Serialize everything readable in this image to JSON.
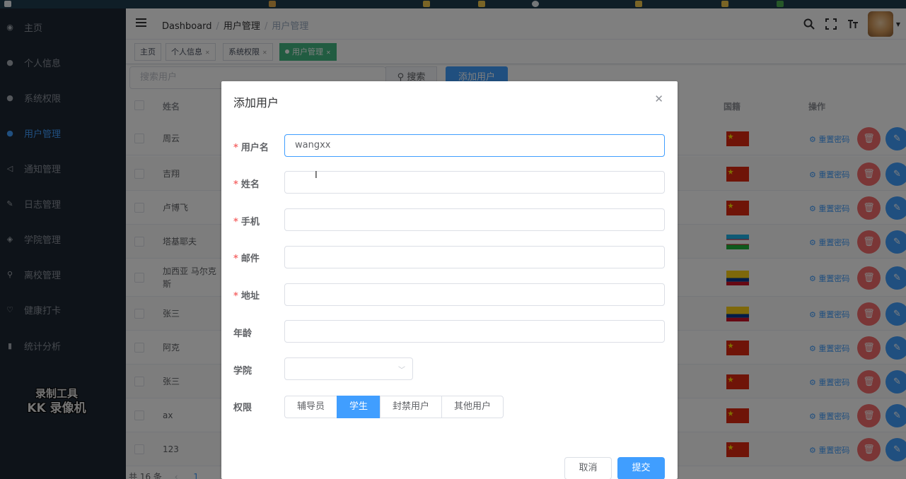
{
  "sidebar": {
    "items": [
      {
        "label": "主页",
        "icon": "dashboard-icon"
      },
      {
        "label": "个人信息",
        "icon": "user-icon"
      },
      {
        "label": "系统权限",
        "icon": "user-icon"
      },
      {
        "label": "用户管理",
        "icon": "users-icon",
        "active": true
      },
      {
        "label": "通知管理",
        "icon": "bell-icon"
      },
      {
        "label": "日志管理",
        "icon": "pen-icon"
      },
      {
        "label": "学院管理",
        "icon": "heart-icon"
      },
      {
        "label": "离校管理",
        "icon": "run-icon"
      },
      {
        "label": "健康打卡",
        "icon": "heart-outline-icon"
      },
      {
        "label": "统计分析",
        "icon": "bar-chart-icon"
      }
    ],
    "watermark": {
      "line1": "录制工具",
      "line2": "KK 录像机"
    }
  },
  "navbar": {
    "breadcrumb": [
      "Dashboard",
      "用户管理",
      "用户管理"
    ]
  },
  "tags": [
    {
      "label": "主页",
      "closable": false
    },
    {
      "label": "个人信息",
      "closable": true
    },
    {
      "label": "系统权限",
      "closable": true
    },
    {
      "label": "用户管理",
      "closable": true,
      "active": true
    }
  ],
  "filter": {
    "search_placeholder": "搜索用户",
    "search_button": "搜索",
    "add_button": "添加用户"
  },
  "table": {
    "headers": {
      "name": "姓名",
      "country": "国籍",
      "actions": "操作"
    },
    "reset_label": "重置密码",
    "rows": [
      {
        "name": "周云",
        "flag": "cn"
      },
      {
        "name": "吉翔",
        "flag": "cn"
      },
      {
        "name": "卢博飞",
        "flag": "cn"
      },
      {
        "name": "塔基耶夫",
        "flag": "uz"
      },
      {
        "name": "加西亚 马尔克斯",
        "flag": "co"
      },
      {
        "name": "张三",
        "flag": "co"
      },
      {
        "name": "阿克",
        "flag": "cn"
      },
      {
        "name": "张三",
        "flag": "cn"
      },
      {
        "name": "ax",
        "flag": "cn"
      },
      {
        "name": "123",
        "flag": "cn"
      }
    ],
    "pager_text": "共 16 条",
    "pager_page": "1"
  },
  "dialog": {
    "title": "添加用户",
    "fields": {
      "username": {
        "label": "用户名",
        "value": "wangxx",
        "required": true
      },
      "name": {
        "label": "姓名",
        "value": "",
        "required": true
      },
      "phone": {
        "label": "手机",
        "value": "",
        "required": true
      },
      "email": {
        "label": "邮件",
        "value": "",
        "required": true
      },
      "address": {
        "label": "地址",
        "value": "",
        "required": true
      },
      "age": {
        "label": "年龄",
        "value": "",
        "required": false
      },
      "college": {
        "label": "学院",
        "value": "",
        "required": false
      },
      "role": {
        "label": "权限"
      }
    },
    "roles": [
      "辅导员",
      "学生",
      "封禁用户",
      "其他用户"
    ],
    "selected_role": "学生",
    "cancel_label": "取消",
    "submit_label": "提交"
  },
  "colors": {
    "primary": "#409eff",
    "danger": "#f56c6c",
    "tag_active": "#42b983",
    "sidebar_bg": "#1c2733"
  }
}
